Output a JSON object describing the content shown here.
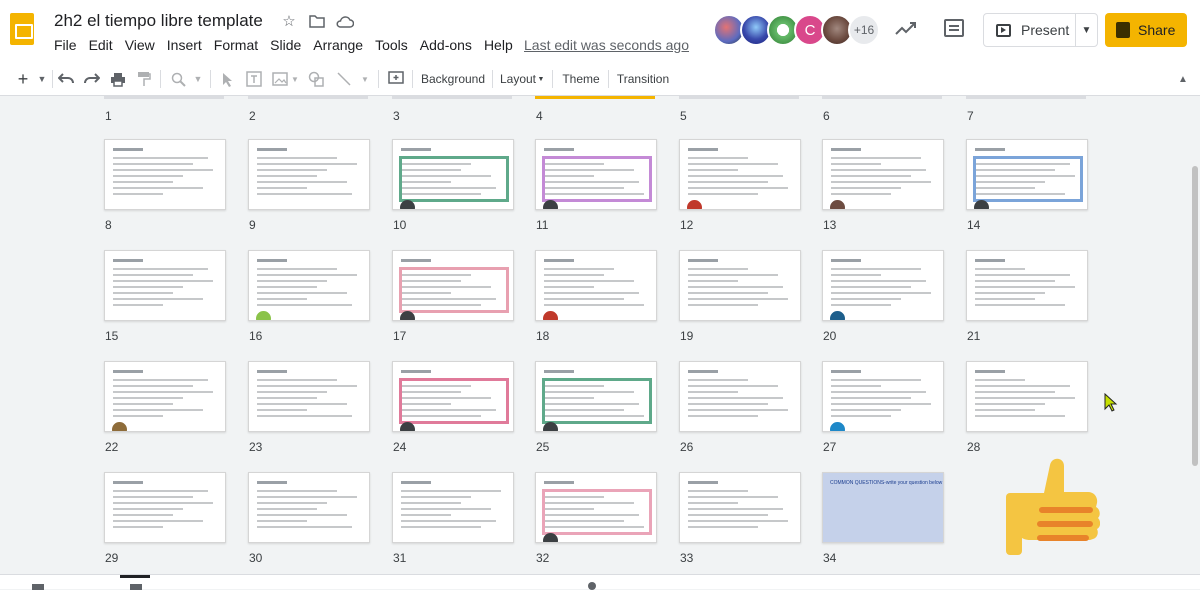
{
  "app": {
    "title": "2h2 el tiempo libre template",
    "icons": [
      "star-icon",
      "move-to-folder-icon",
      "cloud-saved-icon"
    ]
  },
  "menu": [
    "File",
    "Edit",
    "View",
    "Insert",
    "Format",
    "Slide",
    "Arrange",
    "Tools",
    "Add-ons",
    "Help"
  ],
  "last_edit": "Last edit was seconds ago",
  "collaborators": {
    "avatars": [
      "avatar-1",
      "avatar-2",
      "avatar-3",
      "C",
      "avatar-5"
    ],
    "more_count": "+16"
  },
  "header_buttons": {
    "present_label": "Present",
    "share_label": "Share"
  },
  "toolbar": {
    "background_label": "Background",
    "layout_label": "Layout",
    "theme_label": "Theme",
    "transition_label": "Transition"
  },
  "grid": {
    "top_row_numbers": [
      "1",
      "2",
      "3",
      "4",
      "5",
      "6",
      "7"
    ],
    "selected_top": "4",
    "slides": [
      {
        "n": "8"
      },
      {
        "n": "9"
      },
      {
        "n": "10",
        "accent": "#5fa98a"
      },
      {
        "n": "11",
        "accent": "#c48ad6"
      },
      {
        "n": "12",
        "dot": "#c0392b"
      },
      {
        "n": "13",
        "dot": "#6d4c41"
      },
      {
        "n": "14",
        "accent": "#7ba4d9"
      },
      {
        "n": "15"
      },
      {
        "n": "16",
        "dot": "#8bc34a"
      },
      {
        "n": "17",
        "accent": "#e8a0b0"
      },
      {
        "n": "18",
        "dot": "#c0392b"
      },
      {
        "n": "19"
      },
      {
        "n": "20",
        "dot": "#1e5f8c"
      },
      {
        "n": "21"
      },
      {
        "n": "22",
        "dot": "#8e6c3a"
      },
      {
        "n": "23"
      },
      {
        "n": "24",
        "accent": "#e07a9a"
      },
      {
        "n": "25",
        "accent": "#5fa98a"
      },
      {
        "n": "26"
      },
      {
        "n": "27",
        "dot": "#1e88c8"
      },
      {
        "n": "28"
      },
      {
        "n": "29"
      },
      {
        "n": "30"
      },
      {
        "n": "31"
      },
      {
        "n": "32",
        "accent": "#eaa4b8"
      },
      {
        "n": "33"
      },
      {
        "n": "34",
        "special": true
      }
    ],
    "special_slide_text": "COMMON QUESTIONS-write your question below"
  },
  "colors": {
    "brand_yellow": "#f4b400",
    "selected_slide_bg": "#c5d1ea",
    "thumbs_emoji": "#f4c542"
  }
}
